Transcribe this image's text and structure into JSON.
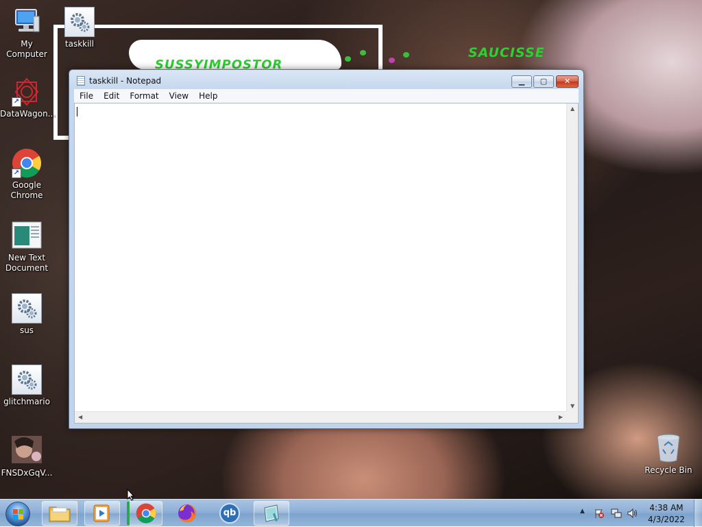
{
  "wallpaper": {
    "text_top": "SUSSYIMPOSTOR",
    "text_right": "SAUCISSE"
  },
  "desktop_icons": [
    {
      "label": "My Computer",
      "icon": "computer-icon"
    },
    {
      "label": "taskkill",
      "icon": "batch-file-icon"
    },
    {
      "label": "DataWagon...",
      "icon": "datawagon-icon"
    },
    {
      "label": "Google Chrome",
      "icon": "chrome-icon"
    },
    {
      "label": "New Text Document",
      "icon": "text-document-icon"
    },
    {
      "label": "sus",
      "icon": "batch-file-icon"
    },
    {
      "label": "glitchmario",
      "icon": "batch-file-icon"
    },
    {
      "label": "FNSDxGqV...",
      "icon": "image-thumbnail-icon"
    },
    {
      "label": "Recycle Bin",
      "icon": "recycle-bin-icon"
    }
  ],
  "notepad": {
    "title": "taskkill - Notepad",
    "menu": [
      "File",
      "Edit",
      "Format",
      "View",
      "Help"
    ],
    "content": ""
  },
  "taskbar": {
    "pinned": [
      {
        "name": "explorer",
        "icon": "folder-icon"
      },
      {
        "name": "media-player",
        "icon": "media-player-icon"
      },
      {
        "name": "chrome",
        "icon": "chrome-icon"
      },
      {
        "name": "firefox",
        "icon": "firefox-icon"
      },
      {
        "name": "qbittorrent",
        "icon": "qbittorrent-icon",
        "text": "qb"
      },
      {
        "name": "notepad",
        "icon": "notepad-icon"
      }
    ],
    "clock": {
      "time": "4:38 AM",
      "date": "4/3/2022"
    }
  }
}
